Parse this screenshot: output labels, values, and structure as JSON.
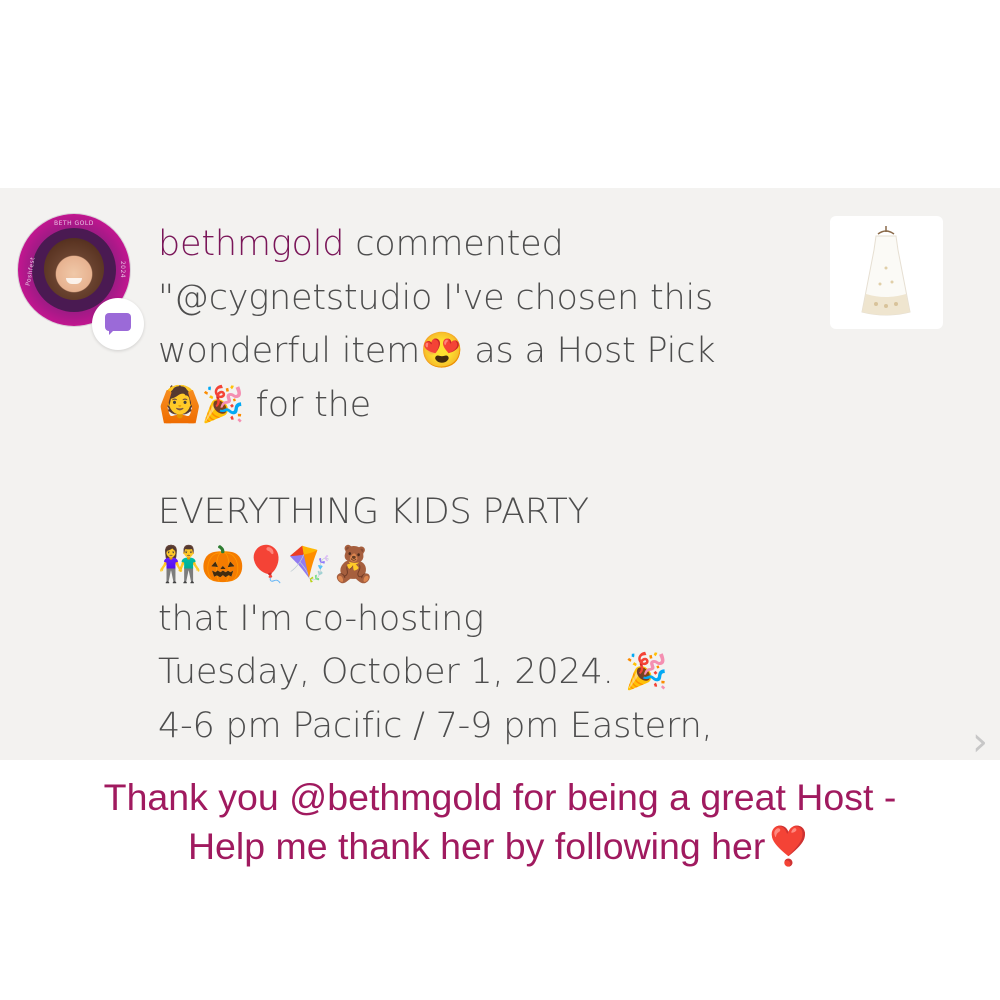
{
  "notification": {
    "username": "bethmgold",
    "action": " commented",
    "comment_lines": [
      "\"@cygnetstudio I've chosen this",
      "wonderful item😍 as a Host Pick",
      "🙆🎉 for the",
      "",
      "EVERYTHING KIDS PARTY",
      "👫🎃🎈🪁🧸",
      "that I'm co-hosting",
      "Tuesday, October 1, 2024. 🎉",
      "4-6 pm Pacific / 7-9 pm Eastern,"
    ],
    "avatar_icon": "profile-photo",
    "badge_icon": "comment-bubble-icon",
    "thumbnail_icon": "white-dress-item-photo",
    "chevron_icon": "chevron-right-icon",
    "avatar_ring_text": [
      "BETH GOLD",
      "2024",
      "Poshfest"
    ]
  },
  "caption": {
    "lines": [
      "Thank you @bethmgold for being a great Host -",
      "Help me thank her by following her❣️"
    ],
    "color": "#a01a5f"
  },
  "colors": {
    "card_background": "#f3f2f0",
    "username": "#7a1659",
    "body_text": "#4d4d4d",
    "badge": "#9b6ad8"
  }
}
